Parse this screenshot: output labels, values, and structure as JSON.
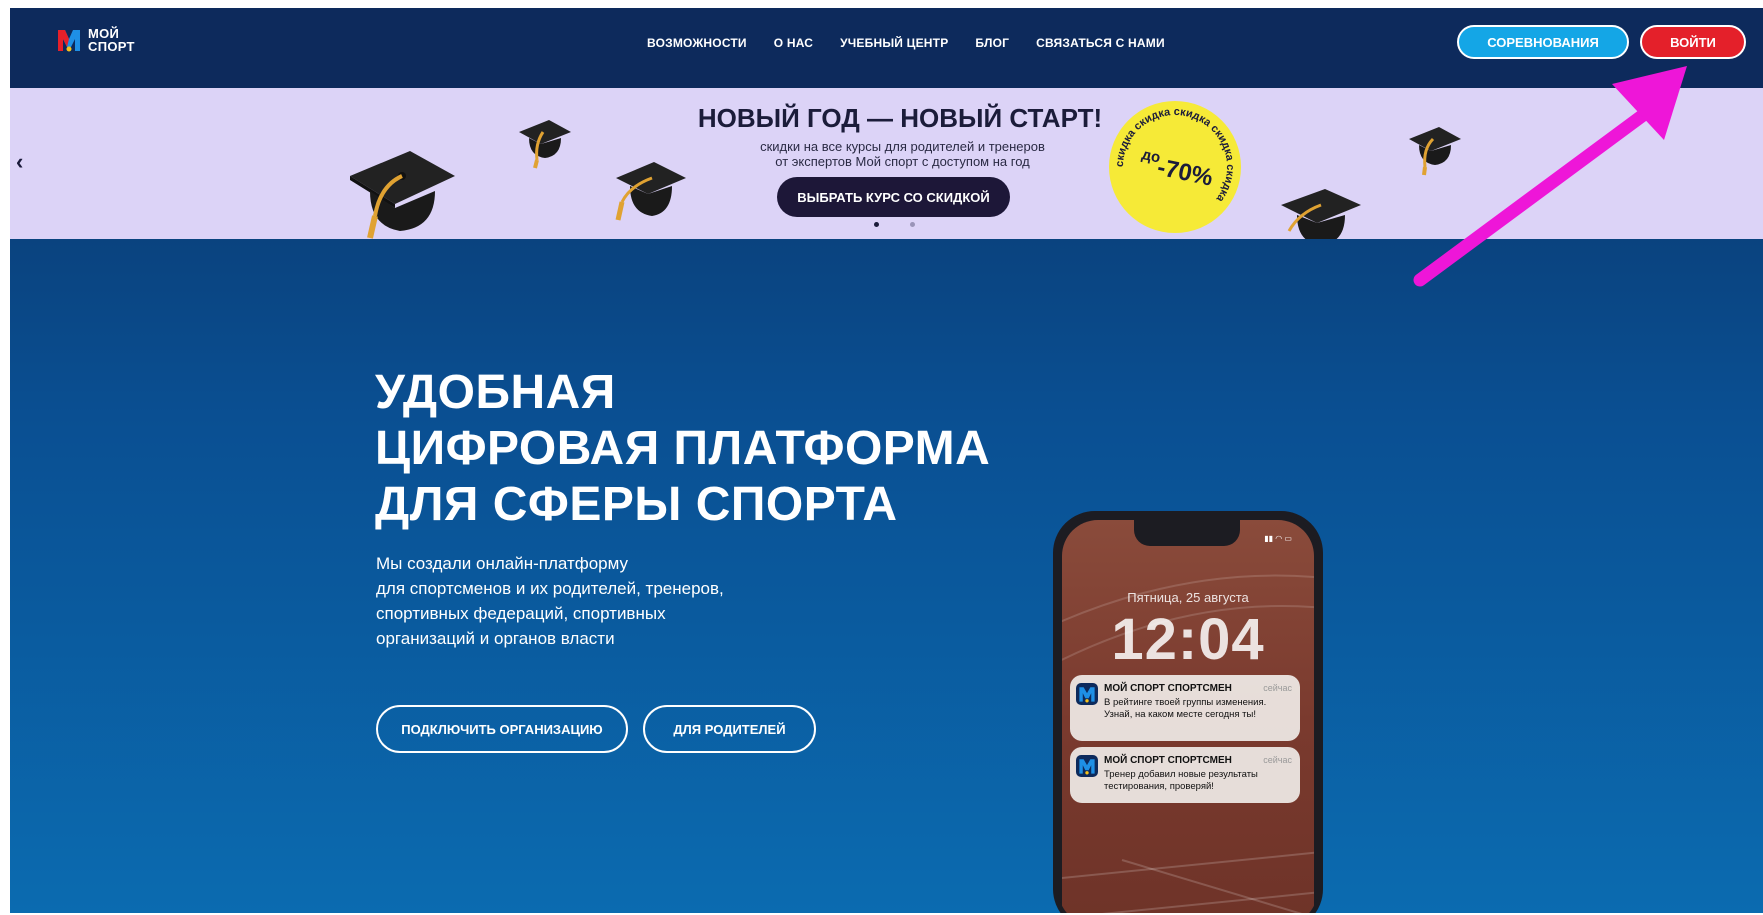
{
  "header": {
    "logo_line1": "МОЙ",
    "logo_line2": "СПОРТ",
    "nav": [
      "ВОЗМОЖНОСТИ",
      "О НАС",
      "УЧЕБНЫЙ ЦЕНТР",
      "БЛОГ",
      "СВЯЗАТЬСЯ С НАМИ"
    ],
    "competitions_label": "СОРЕВНОВАНИЯ",
    "login_label": "ВОЙТИ"
  },
  "banner": {
    "prev_icon": "chevron-left-icon",
    "title": "НОВЫЙ ГОД — НОВЫЙ СТАРТ!",
    "subtitle_line1": "скидки на все курсы для родителей и тренеров",
    "subtitle_line2": "от экспертов Мой спорт с доступом на год",
    "cta_label": "ВЫБРАТЬ КУРС СО СКИДКОЙ",
    "badge_prefix": "до",
    "badge_value": "-70%",
    "badge_ring_text": "скидка скидка скидка скидка скидка",
    "slides": [
      true,
      false
    ]
  },
  "hero": {
    "title_line1": "УДОБНАЯ",
    "title_line2": "ЦИФРОВАЯ ПЛАТФОРМА",
    "title_line3": "ДЛЯ СФЕРЫ СПОРТА",
    "text_line1": "Мы создали онлайн-платформу",
    "text_line2": "для спортсменов и их родителей, тренеров,",
    "text_line3": "спортивных федераций, спортивных",
    "text_line4": "организаций и органов власти",
    "connect_label": "ПОДКЛЮЧИТЬ ОРГАНИЗАЦИЮ",
    "parents_label": "ДЛЯ РОДИТЕЛЕЙ"
  },
  "phone": {
    "date": "Пятница, 25 августа",
    "time": "12:04",
    "notifications": [
      {
        "app": "МОЙ СПОРТ СПОРТСМЕН",
        "when": "сейчас",
        "message": "В рейтинге твоей группы изменения. Узнай, на каком месте сегодня ты!"
      },
      {
        "app": "МОЙ СПОРТ СПОРТСМЕН",
        "when": "сейчас",
        "message": "Тренер добавил новые результаты тестирования, проверяй!"
      }
    ]
  },
  "colors": {
    "topbar": "#0d2a5c",
    "hero_bg_top": "#0b3366",
    "hero_bg_bottom": "#0b6bb0",
    "competitions": "#14a6e6",
    "login": "#e4202a",
    "banner_bg": "#dcd3f7",
    "annotation_arrow": "#ee16d8"
  }
}
